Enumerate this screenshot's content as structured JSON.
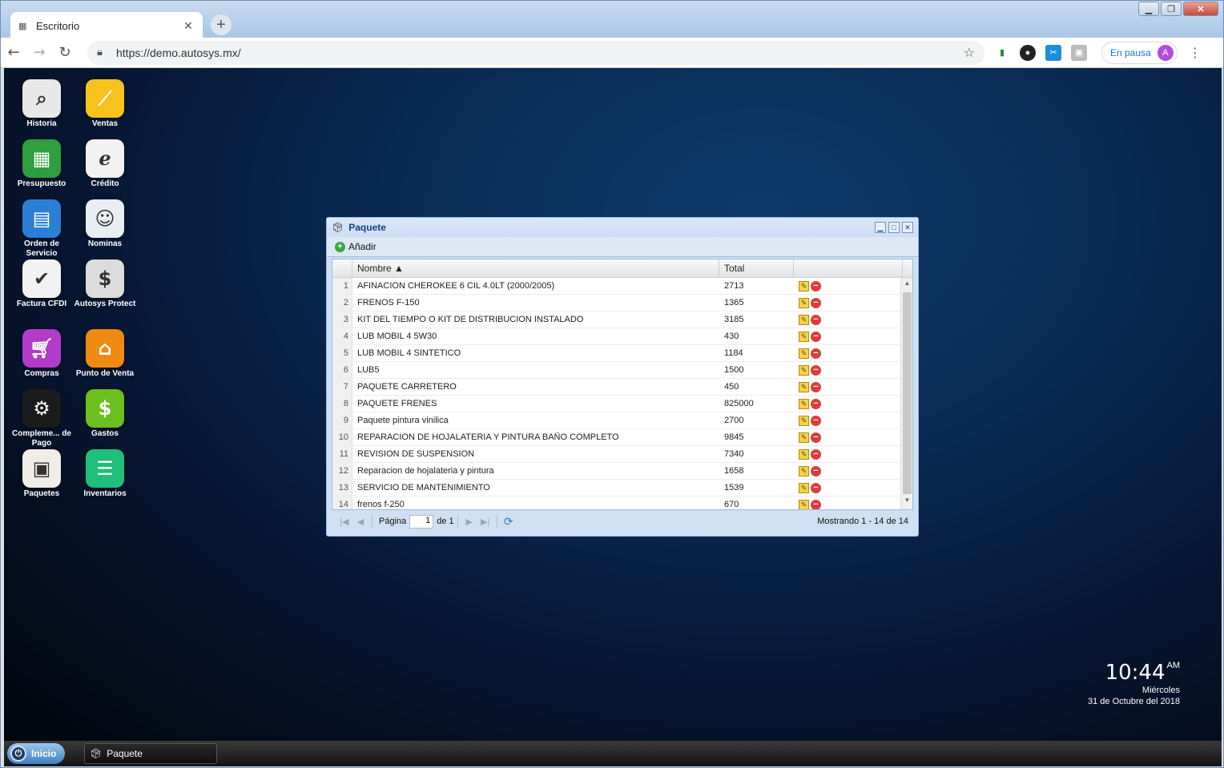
{
  "browser": {
    "tab_title": "Escritorio",
    "url": "https://demo.autosys.mx/",
    "profile_status": "En pausa",
    "profile_initial": "A"
  },
  "desktop": {
    "icons": [
      {
        "label": "Historia",
        "icon": "magnifier-icon",
        "color": "#e8e8e8"
      },
      {
        "label": "Ventas",
        "icon": "chart-line-icon",
        "color": "#f7c21e"
      },
      {
        "label": "Presupuesto",
        "icon": "spreadsheet-icon",
        "color": "#2e9e3e"
      },
      {
        "label": "Crédito",
        "icon": "credit-icon",
        "color": "#f2f2f2"
      },
      {
        "label": "Orden de Servicio",
        "icon": "document-icon",
        "color": "#2b7fd4"
      },
      {
        "label": "Nominas",
        "icon": "payroll-icon",
        "color": "#e9eef2"
      },
      {
        "label": "Factura CFDI",
        "icon": "xml-invoice-icon",
        "color": "#f2f2f2"
      },
      {
        "label": "Autosys Protect",
        "icon": "protect-icon",
        "color": "#dcdcdc"
      },
      {
        "label": "Compras",
        "icon": "cart-icon",
        "color": "#b23bc9"
      },
      {
        "label": "Punto de Venta",
        "icon": "store-icon",
        "color": "#f08a12"
      },
      {
        "label": "Compleme... de Pago",
        "icon": "steam-icon",
        "color": "#1b1b1b"
      },
      {
        "label": "Gastos",
        "icon": "money-icon",
        "color": "#6bbf1e"
      },
      {
        "label": "Paquetes",
        "icon": "box-icon",
        "color": "#f0ece6"
      },
      {
        "label": "Inventarios",
        "icon": "list-icon",
        "color": "#1ebf7a"
      }
    ]
  },
  "window": {
    "title": "Paquete",
    "add_label": "Añadir",
    "columns": {
      "name": "Nombre ▲",
      "total": "Total"
    },
    "rows": [
      {
        "n": "1",
        "name": "AFINACION CHEROKEE 6 CIL 4.0LT (2000/2005)",
        "total": "2713"
      },
      {
        "n": "2",
        "name": "FRENOS F-150",
        "total": "1365"
      },
      {
        "n": "3",
        "name": "KIT DEL TIEMPO O KIT DE DISTRIBUCION INSTALADO",
        "total": "3185"
      },
      {
        "n": "4",
        "name": "LUB MOBIL 4 5W30",
        "total": "430"
      },
      {
        "n": "5",
        "name": "LUB MOBIL 4 SINTETICO",
        "total": "1184"
      },
      {
        "n": "6",
        "name": "LUB5",
        "total": "1500"
      },
      {
        "n": "7",
        "name": "PAQUETE CARRETERO",
        "total": "450"
      },
      {
        "n": "8",
        "name": "PAQUETE FRENES",
        "total": "825000"
      },
      {
        "n": "9",
        "name": "Paquete pintura vinilica",
        "total": "2700"
      },
      {
        "n": "10",
        "name": "REPARACION DE HOJALATERIA Y PINTURA BAÑO COMPLETO",
        "total": "9845"
      },
      {
        "n": "11",
        "name": "REVISION DE SUSPENSION",
        "total": "7340"
      },
      {
        "n": "12",
        "name": "Reparacion de hojalateria y pintura",
        "total": "1658"
      },
      {
        "n": "13",
        "name": "SERVICIO DE MANTENIMIENTO",
        "total": "1539"
      },
      {
        "n": "14",
        "name": "frenos f-250",
        "total": "670"
      }
    ],
    "pager": {
      "page_label": "Página",
      "page_value": "1",
      "of_label": "de 1",
      "info": "Mostrando 1 - 14 de 14"
    }
  },
  "clock": {
    "time": "10:44",
    "ampm": "AM",
    "weekday": "Miércoles",
    "date": "31 de Octubre del 2018"
  },
  "taskbar": {
    "start_label": "Inicio",
    "task_label": "Paquete"
  }
}
